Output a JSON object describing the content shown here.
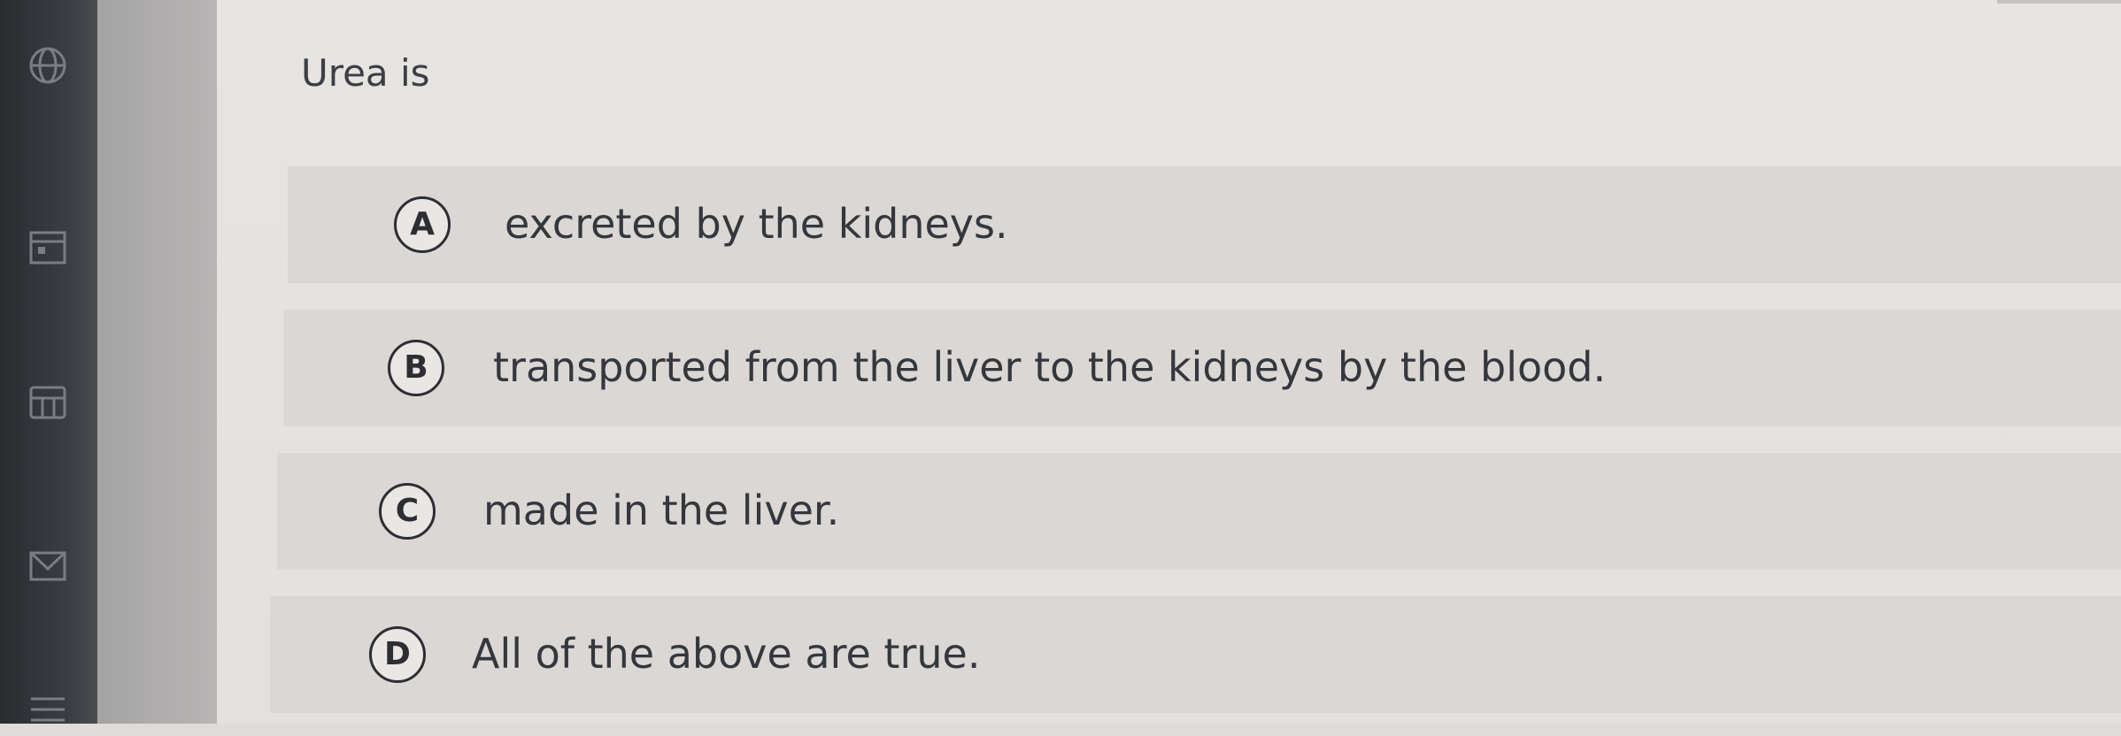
{
  "question": {
    "text": "Urea is"
  },
  "options": [
    {
      "letter": "A",
      "text": "excreted by the kidneys."
    },
    {
      "letter": "B",
      "text": "transported from the liver to the kidneys by the blood."
    },
    {
      "letter": "C",
      "text": "made in the liver."
    },
    {
      "letter": "D",
      "text": "All of the above are true."
    }
  ],
  "sidebar_icons": [
    "globe-icon",
    "calendar-icon",
    "grid-icon",
    "mail-icon",
    "menu-icon"
  ],
  "colors": {
    "page_background": "#e5e2df",
    "option_background": "#dad7d4",
    "text": "#34373d",
    "sidebar": "#2f3135"
  }
}
